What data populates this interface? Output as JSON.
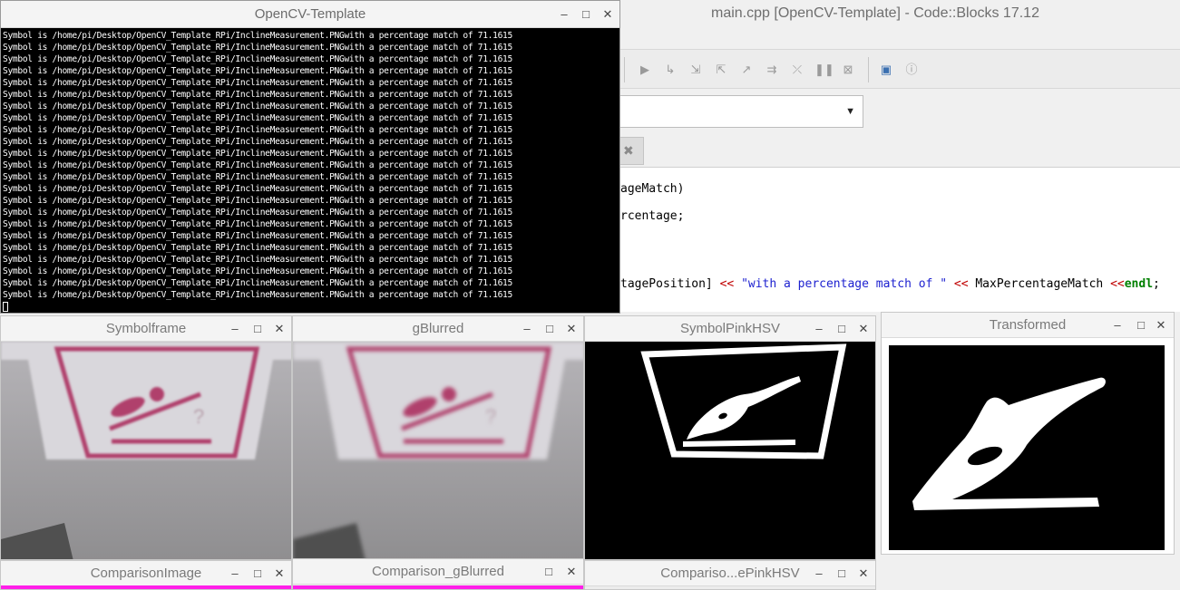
{
  "codeblocks": {
    "title": "main.cpp [OpenCV-Template] - Code::Blocks 17.12",
    "code_lines": [
      {
        "parts": [
          {
            "t": "ageMatch)",
            "c": "plain"
          }
        ]
      },
      {
        "parts": [
          {
            "t": "rcentage;",
            "c": "plain"
          }
        ]
      },
      {
        "parts": [
          {
            "t": "tagePosition] ",
            "c": "plain"
          },
          {
            "t": "<<",
            "c": "op"
          },
          {
            "t": " ",
            "c": "plain"
          },
          {
            "t": "\"with a percentage match of \"",
            "c": "str"
          },
          {
            "t": " ",
            "c": "plain"
          },
          {
            "t": "<<",
            "c": "op"
          },
          {
            "t": " MaxPercentageMatch ",
            "c": "plain"
          },
          {
            "t": "<<",
            "c": "op"
          },
          {
            "t": "endl",
            "c": "kw"
          },
          {
            "t": ";",
            "c": "plain"
          }
        ]
      }
    ],
    "toolbar_icons": [
      "run-icon",
      "step-over-icon",
      "step-into-icon",
      "step-out-icon",
      "next-instruction-icon",
      "step-into-instruction-icon",
      "break-icon",
      "pause-icon",
      "stop-icon",
      "debug-windows-icon",
      "info-icon"
    ]
  },
  "console": {
    "title": "OpenCV-Template",
    "line": "Symbol is /home/pi/Desktop/OpenCV_Template_RPi/InclineMeasurement.PNGwith a percentage match of 71.1615",
    "line_count": 23,
    "controls": {
      "minimize": "–",
      "maximize": "□",
      "close": "✕"
    }
  },
  "windows": {
    "symbolframe": {
      "title": "Symbolframe"
    },
    "gblurred": {
      "title": "gBlurred"
    },
    "symbolpinkhsv": {
      "title": "SymbolPinkHSV"
    },
    "transformed": {
      "title": "Transformed"
    },
    "comparisonimage": {
      "title": "ComparisonImage"
    },
    "comparison_gblurred": {
      "title": "Comparison_gBlurred"
    },
    "comparisonpinkhsv": {
      "title": "Compariso...ePinkHSV"
    }
  },
  "colors": {
    "sign_pink": "#b0406c",
    "highlight_pink": "#ff1ee8",
    "console_bg": "#000000",
    "string_blue": "#1e22d0",
    "operator_red": "#c00000",
    "keyword_green": "#008000"
  }
}
